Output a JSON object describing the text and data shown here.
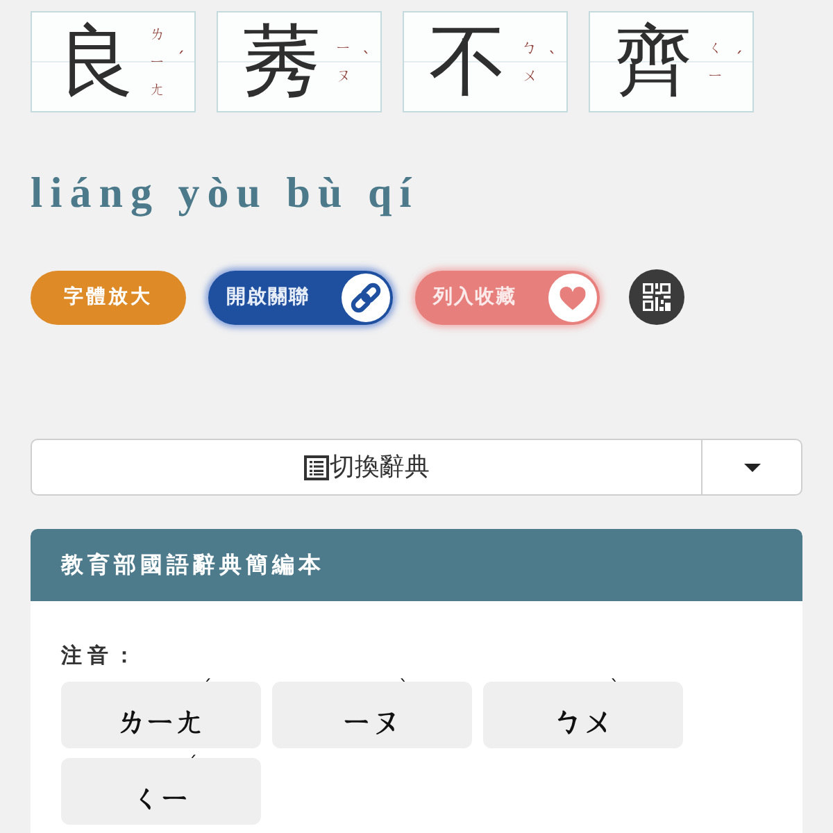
{
  "characters": [
    {
      "hanzi": "良",
      "zhuyin": "ㄌㄧㄤ",
      "tone": "ˊ"
    },
    {
      "hanzi": "莠",
      "zhuyin": "ㄧㄡ",
      "tone": "ˋ"
    },
    {
      "hanzi": "不",
      "zhuyin": "ㄅㄨ",
      "tone": "ˋ"
    },
    {
      "hanzi": "齊",
      "zhuyin": "ㄑㄧ",
      "tone": "ˊ"
    }
  ],
  "pinyin": "liáng yòu bù qí",
  "actions": [
    {
      "kind": "enlarge",
      "label": "字體放大"
    },
    {
      "kind": "link",
      "label": "開啟關聯"
    },
    {
      "kind": "favorite",
      "label": "列入收藏"
    },
    {
      "kind": "qr"
    }
  ],
  "dictionary_switch": {
    "label": "切換辭典",
    "expanded": false
  },
  "panel": {
    "title": "教育部國語辭典簡編本",
    "zhuyin_label": "注音：",
    "pronunciations": [
      {
        "zhuyin": "ㄌㄧㄤ",
        "tone": "ˊ"
      },
      {
        "zhuyin": "ㄧㄡ",
        "tone": "ˋ"
      },
      {
        "zhuyin": "ㄅㄨ",
        "tone": "ˋ"
      },
      {
        "zhuyin": "ㄑㄧ",
        "tone": "ˊ"
      }
    ]
  }
}
